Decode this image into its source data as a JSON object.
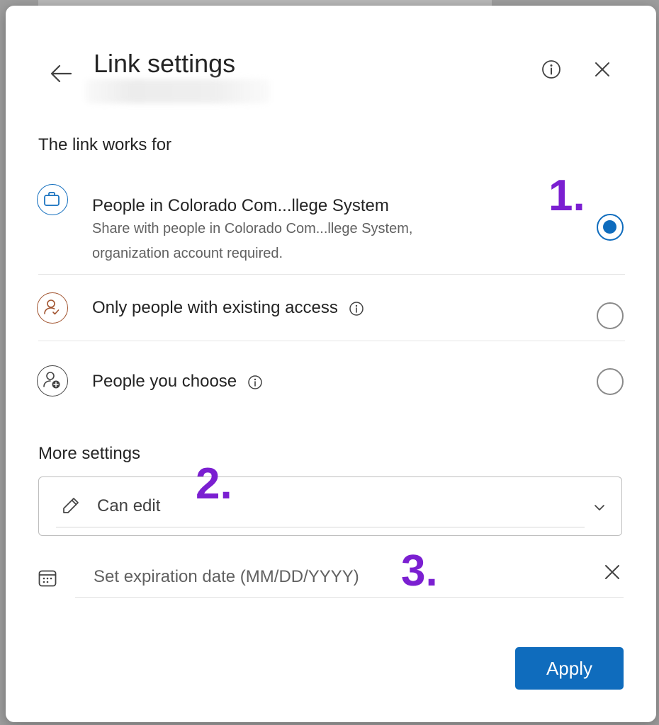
{
  "dialog": {
    "title": "Link settings",
    "colors": {
      "accent": "#0f6cbd",
      "annotation": "#7b1fd1"
    }
  },
  "link_works_for": {
    "heading": "The link works for",
    "options": [
      {
        "title": "People in Colorado Com...llege System",
        "description_line1": "Share with people in Colorado Com...llege System,",
        "description_line2": "organization account required.",
        "icon": "briefcase-icon",
        "selected": true
      },
      {
        "title": "Only people with existing access",
        "icon": "person-check-icon",
        "selected": false
      },
      {
        "title": "People you choose",
        "icon": "person-add-icon",
        "selected": false
      }
    ]
  },
  "more_settings": {
    "heading": "More settings",
    "permission": {
      "value": "Can edit",
      "icon": "pencil-icon"
    },
    "expiration": {
      "placeholder": "Set expiration date (MM/DD/YYYY)",
      "value": ""
    }
  },
  "annotations": [
    "1.",
    "2.",
    "3."
  ],
  "footer": {
    "apply_label": "Apply"
  }
}
